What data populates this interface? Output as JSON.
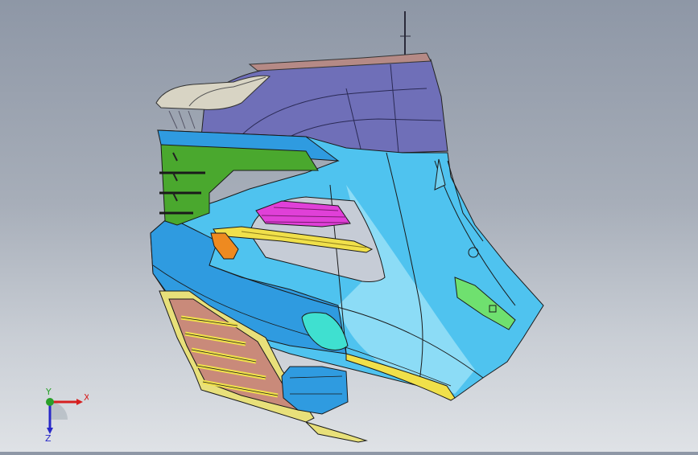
{
  "viewport": {
    "background_top": "#8e97a6",
    "background_bottom": "#dfe2e6",
    "model": {
      "part_colors": {
        "roof_spoiler": "#6f6fb8",
        "roof_rail": "#d8d4c4",
        "body_panel": "#4fc3ef",
        "lower_bumper": "#2f9be0",
        "grille": "#4aa82e",
        "louver": "#e040d8",
        "side_trim": "#f0e04a",
        "orange_lamp": "#ee8a20",
        "reflector": "#3fe0d0",
        "bracket": "#6fe06f",
        "lower_vent_frame": "#e8e07a",
        "vent_slats": "#c98a7a"
      }
    }
  },
  "triad": {
    "x_label": "X",
    "y_label": "Y",
    "z_label": "Z",
    "x_color": "#d62020",
    "y_color": "#2aa02a",
    "z_color": "#2828c8"
  }
}
